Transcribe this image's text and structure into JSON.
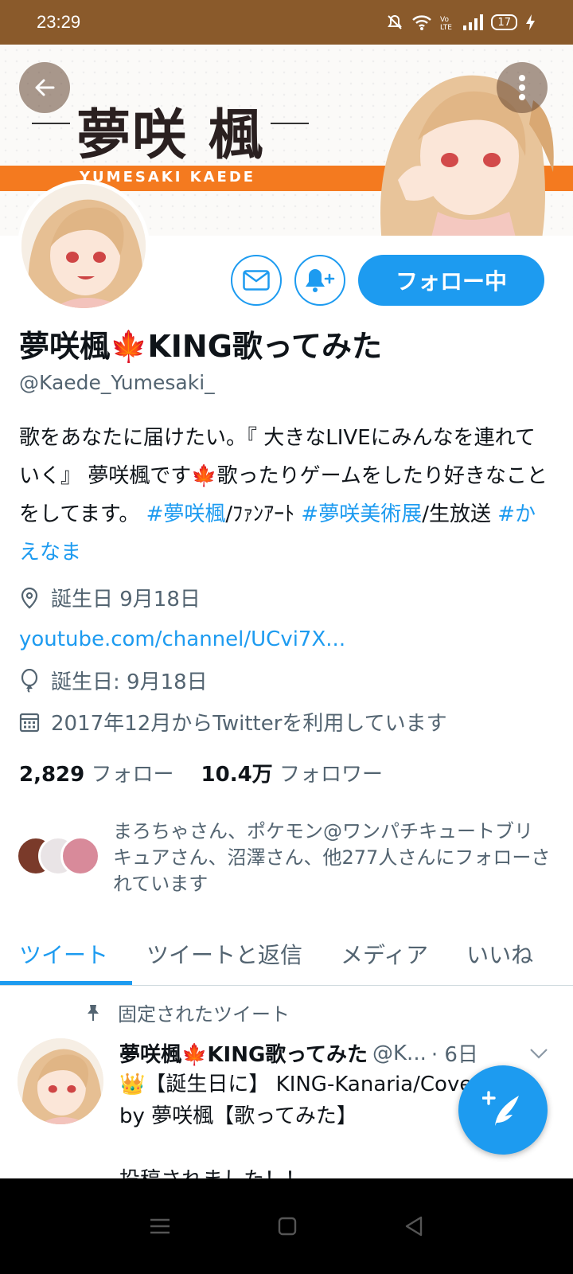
{
  "status_bar": {
    "time": "23:29",
    "battery": "17"
  },
  "banner": {
    "title": "夢咲 楓",
    "subtitle": "YUMESAKI KAEDE"
  },
  "profile": {
    "name": "夢咲楓🍁KING歌ってみた",
    "handle": "@Kaede_Yumesaki_",
    "bio_text": "歌をあなたに届けたい。『 大きなLIVEにみんなを連れていく』 夢咲楓です🍁歌ったりゲームをしたり好きなことをしてます。 ",
    "bio_tag1": "#夢咲楓",
    "bio_mid1": "/ﾌｧﾝｱｰﾄ ",
    "bio_tag2": "#夢咲美術展",
    "bio_mid2": "/生放送 ",
    "bio_tag3": "#かえなま",
    "location": "誕生日 9月18日",
    "link": "youtube.com/channel/UCvi7X...",
    "birthday": "誕生日: 9月18日",
    "joined": "2017年12月からTwitterを利用しています",
    "follow_button": "フォロー中"
  },
  "counts": {
    "following_num": "2,829",
    "following_label": "フォロー",
    "followers_num": "10.4万",
    "followers_label": "フォロワー"
  },
  "known_followers": "まろちゃさん、ポケモン@ワンパチキュートブリキュアさん、沼澤さん、他277人さんにフォローされています",
  "tabs": [
    {
      "label": "ツイート"
    },
    {
      "label": "ツイートと返信"
    },
    {
      "label": "メディア"
    },
    {
      "label": "いいね"
    }
  ],
  "tweet": {
    "pinned_label": "固定されたツイート",
    "name": "夢咲楓🍁KING歌ってみた",
    "handle": "@K...",
    "time": "· 6日",
    "body": "👑【誕生日に】 KING-Kanaria/Cover ed by 夢咲楓【歌ってみた】\n\n投稿されました！！"
  },
  "colors": {
    "accent": "#1d9bf0",
    "status_bar": "#8a5a2b",
    "banner_strip": "#f47a1f"
  }
}
